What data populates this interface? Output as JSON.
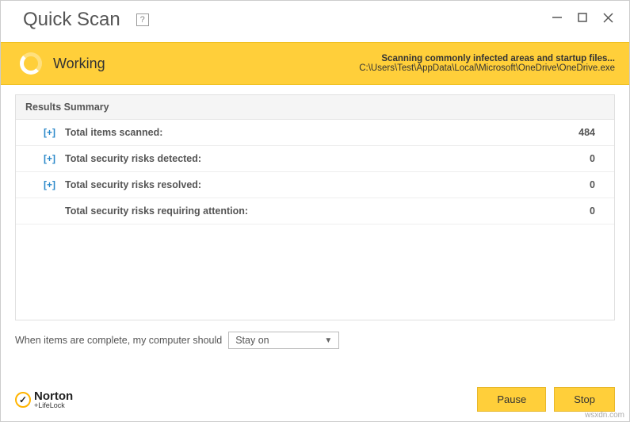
{
  "window": {
    "title": "Quick Scan",
    "help": "?"
  },
  "status": {
    "label": "Working",
    "headline": "Scanning commonly infected areas and startup files...",
    "current_path": "C:\\Users\\Test\\AppData\\Local\\Microsoft\\OneDrive\\OneDrive.exe"
  },
  "results": {
    "header": "Results Summary",
    "rows": {
      "scanned": {
        "expand": "[+]",
        "label": "Total items scanned:",
        "value": "484"
      },
      "detected": {
        "expand": "[+]",
        "label": "Total security risks detected:",
        "value": "0"
      },
      "resolved": {
        "expand": "[+]",
        "label": "Total security risks resolved:",
        "value": "0"
      },
      "attention": {
        "label": "Total security risks requiring attention:",
        "value": "0"
      }
    }
  },
  "action": {
    "prompt": "When items are complete, my computer should",
    "selected": "Stay on"
  },
  "footer": {
    "brand": "Norton",
    "subbrand": "+LifeLock",
    "pause": "Pause",
    "stop": "Stop"
  },
  "watermark": "wsxdn.com"
}
